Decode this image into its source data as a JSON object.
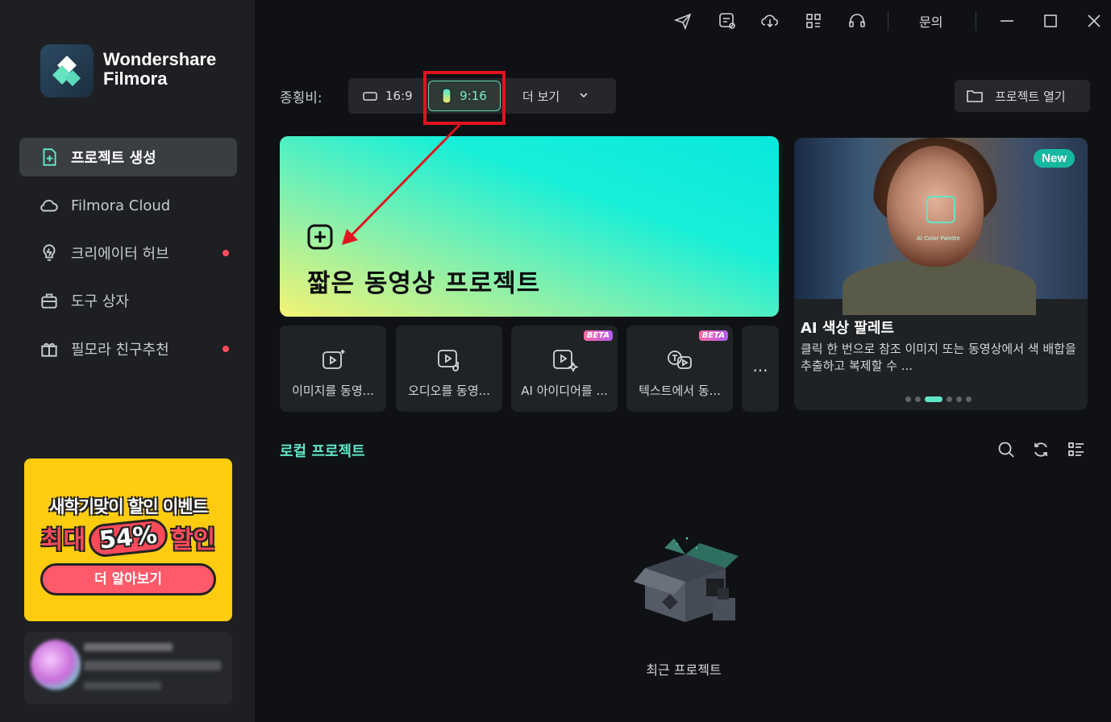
{
  "app": {
    "brand_line1": "Wondershare",
    "brand_line2": "Filmora"
  },
  "titlebar": {
    "inquiry_label": "문의",
    "icons": [
      "send-icon",
      "calendar-list-icon",
      "cloud-download-icon",
      "grid-icon",
      "headset-icon",
      "minimize-icon",
      "maximize-icon",
      "close-icon"
    ]
  },
  "sidebar": {
    "items": [
      {
        "label": "프로젝트 생성",
        "icon": "new-project-icon",
        "active": true
      },
      {
        "label": "Filmora Cloud",
        "icon": "cloud-icon"
      },
      {
        "label": "크리에이터 허브",
        "icon": "bulb-icon",
        "badge_dot": true
      },
      {
        "label": "도구 상자",
        "icon": "toolbox-icon"
      },
      {
        "label": "필모라 친구추천",
        "icon": "gift-icon",
        "badge_dot": true
      }
    ],
    "promo": {
      "line1": "새학기맞이 할인 이벤트",
      "line2_prefix": "최대",
      "line2_percent": "54%",
      "line2_suffix": "할인",
      "button": "더 알아보기"
    }
  },
  "ratio": {
    "label": "종횡비:",
    "options": [
      "16:9",
      "9:16"
    ],
    "selected": "9:16",
    "more_label": "더 보기"
  },
  "open_project": "프로젝트 열기",
  "hero": {
    "title": "짧은 동영상 프로젝트"
  },
  "feature": {
    "badge": "New",
    "image_caption": "AI Color Palette",
    "title": "AI 색상 팔레트",
    "description": "클릭 한 번으로 참조 이미지 또는 동영상에서 색 배합을 추출하고 복제할 수 ..."
  },
  "tools": [
    {
      "label": "이미지를 동영...",
      "icon": "image-to-video-icon",
      "beta": false
    },
    {
      "label": "오디오를 동영...",
      "icon": "audio-to-video-icon",
      "beta": false
    },
    {
      "label": "AI 아이디어를 ...",
      "icon": "ai-idea-video-icon",
      "beta": true
    },
    {
      "label": "텍스트에서 동...",
      "icon": "text-to-video-icon",
      "beta": true
    }
  ],
  "beta_label": "BETA",
  "more_tools": "...",
  "local": {
    "title": "로컬 프로젝트",
    "empty_label": "최근 프로젝트"
  },
  "colors": {
    "accent": "#5fe6c8",
    "highlight": "#e0141f",
    "badge_dot": "#ff4d5e",
    "promo_bg": "#ffcc10"
  }
}
